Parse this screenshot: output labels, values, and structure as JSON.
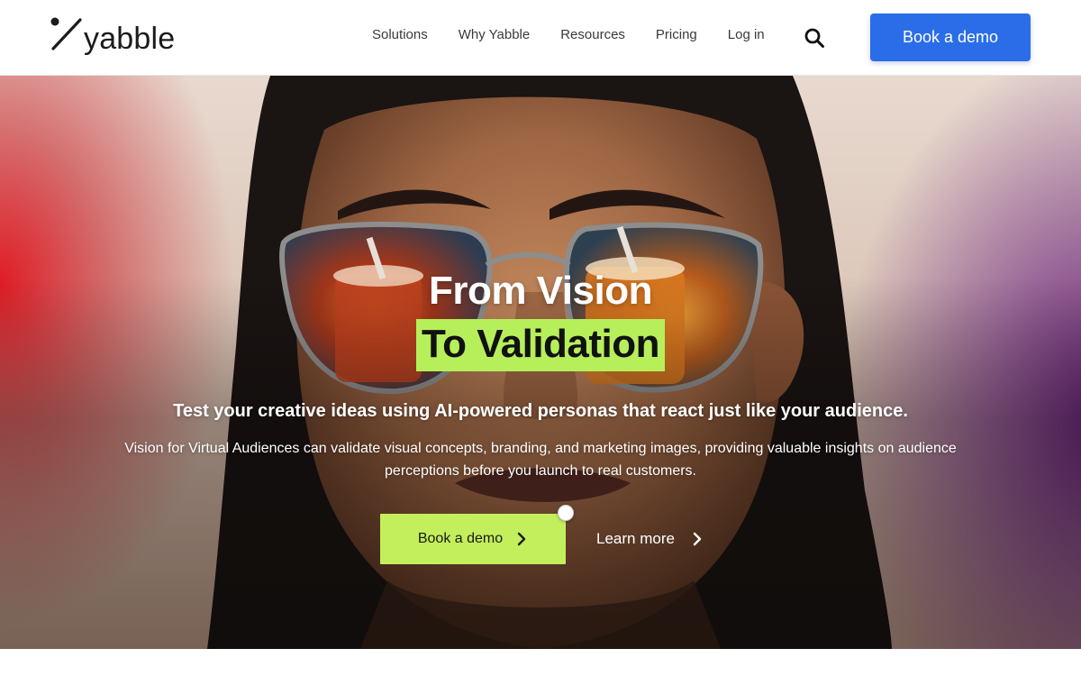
{
  "header": {
    "logo_text": "yabble",
    "nav": [
      {
        "label": "Solutions"
      },
      {
        "label": "Why Yabble"
      },
      {
        "label": "Resources"
      },
      {
        "label": "Pricing"
      },
      {
        "label": "Log in"
      }
    ],
    "search_icon": "search-icon",
    "cta_label": "Book a demo"
  },
  "hero": {
    "title_line1": "From Vision",
    "title_line2": "To Validation",
    "subtitle": "Test your creative ideas using AI-powered personas that react just like your audience.",
    "body": "Vision for Virtual Audiences can validate visual concepts, branding, and marketing images, providing valuable insights on audience perceptions before you launch to real customers.",
    "primary_cta": "Book a demo",
    "secondary_cta": "Learn more"
  },
  "colors": {
    "brand_blue": "#2b6de8",
    "accent_lime": "#c3ef5c",
    "highlight_lime": "#b6ef5a",
    "text_dark": "#1b1b1b"
  }
}
